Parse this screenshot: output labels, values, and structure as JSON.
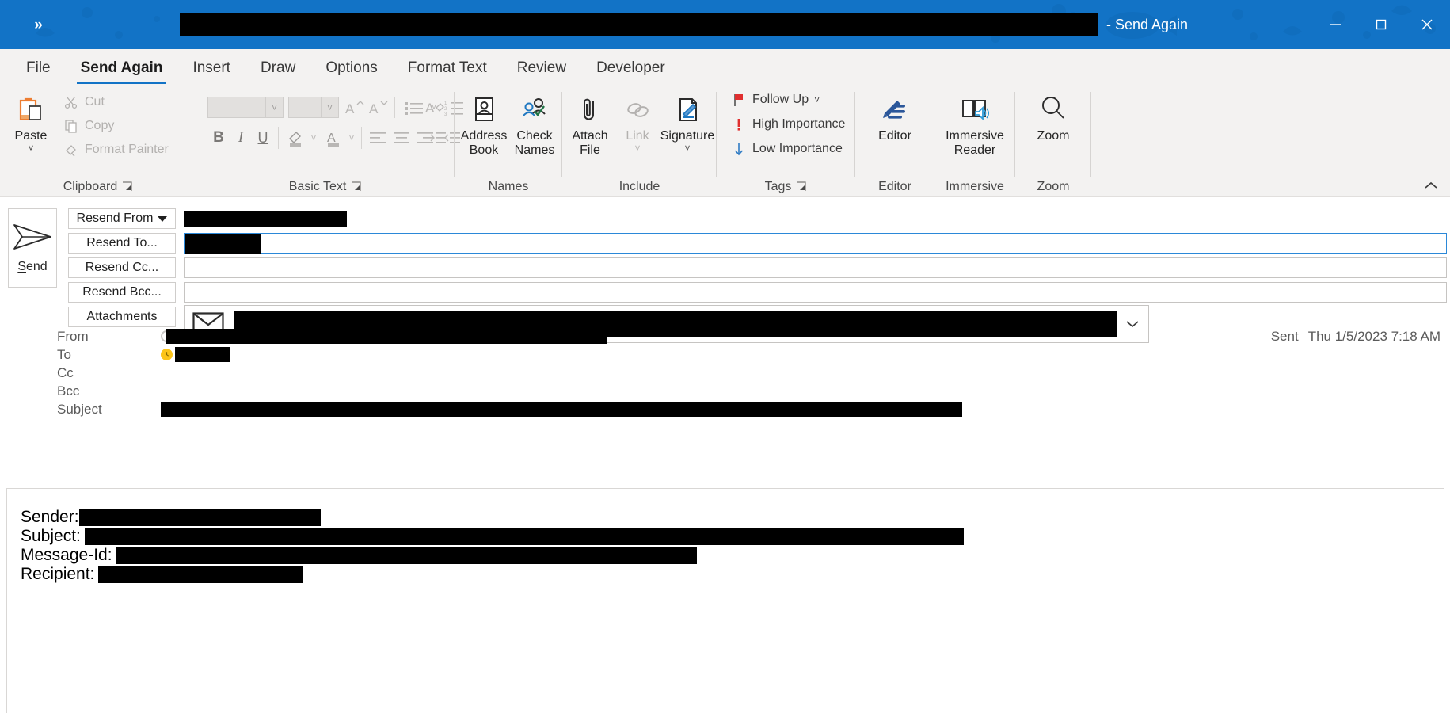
{
  "window": {
    "title_suffix": "- Send Again",
    "title_redacted_width": 1160,
    "quick_access_toggle": "»",
    "accent_color": "#1273c6",
    "buttons": {
      "minimize": "minimize-button",
      "maximize": "maximize-button",
      "close": "close-button"
    }
  },
  "tabs": [
    {
      "label": "File",
      "active": false
    },
    {
      "label": "Send Again",
      "active": true
    },
    {
      "label": "Insert",
      "active": false
    },
    {
      "label": "Draw",
      "active": false
    },
    {
      "label": "Options",
      "active": false
    },
    {
      "label": "Format Text",
      "active": false
    },
    {
      "label": "Review",
      "active": false
    },
    {
      "label": "Developer",
      "active": false
    }
  ],
  "ribbon": {
    "collapse_tooltip": "∧",
    "groups": [
      {
        "name": "Clipboard",
        "label": "Clipboard",
        "has_launcher": true
      },
      {
        "name": "Basic Text",
        "label": "Basic Text",
        "has_launcher": true
      },
      {
        "name": "Names",
        "label": "Names",
        "has_launcher": false
      },
      {
        "name": "Include",
        "label": "Include",
        "has_launcher": false
      },
      {
        "name": "Tags",
        "label": "Tags",
        "has_launcher": true
      },
      {
        "name": "Editor",
        "label": "Editor",
        "has_launcher": false
      },
      {
        "name": "Immersive",
        "label": "Immersive",
        "has_launcher": false
      },
      {
        "name": "Zoom",
        "label": "Zoom",
        "has_launcher": false
      }
    ],
    "clipboard": {
      "paste": "Paste",
      "cut": "Cut",
      "copy": "Copy",
      "format_painter": "Format Painter"
    },
    "basic_text": {
      "font_name_value": "",
      "font_size_value": "",
      "grow_font": "A",
      "shrink_font": "A",
      "bold": "B",
      "italic": "I",
      "underline": "U"
    },
    "names": {
      "address_book": "Address\nBook",
      "check_names": "Check\nNames"
    },
    "include": {
      "attach_file": "Attach\nFile",
      "link": "Link",
      "signature": "Signature"
    },
    "tags": {
      "follow_up": "Follow Up",
      "high_importance": "High Importance",
      "low_importance": "Low Importance"
    },
    "editor": {
      "label": "Editor"
    },
    "immersive": {
      "label": "Immersive\nReader"
    },
    "zoom": {
      "label": "Zoom"
    }
  },
  "compose": {
    "send_button": "Send",
    "resend_from": "Resend From",
    "resend_to": "Resend To...",
    "resend_cc": "Resend Cc...",
    "resend_bcc": "Resend Bcc...",
    "attachments": "Attachments",
    "from_field_redacted_width": 240,
    "to_field_redacted_width": 96,
    "cc_field_value": "",
    "bcc_field_value": "",
    "attachment_redacted": true
  },
  "headers": {
    "rows": [
      {
        "label": "From",
        "presence": "offline",
        "presence_color": "#c8c6c4",
        "redact_width": 562
      },
      {
        "label": "To",
        "presence": "away",
        "presence_color": "#fcc419",
        "redact_width": 70
      },
      {
        "label": "Cc",
        "presence": "none",
        "presence_color": "",
        "redact_width": 0
      },
      {
        "label": "Bcc",
        "presence": "none",
        "presence_color": "",
        "redact_width": 0
      },
      {
        "label": "Subject",
        "presence": "none",
        "presence_color": "",
        "redact_width": 1012
      }
    ],
    "sent_label": "Sent",
    "sent_value": "Thu 1/5/2023 7:18 AM"
  },
  "body": {
    "lines": [
      {
        "label": "Sender:",
        "redact_width": 305
      },
      {
        "label": "Subject:",
        "redact_width": 1110
      },
      {
        "label": "Message-Id:",
        "redact_width": 733
      },
      {
        "label": "Recipient:",
        "redact_width": 259
      }
    ]
  }
}
